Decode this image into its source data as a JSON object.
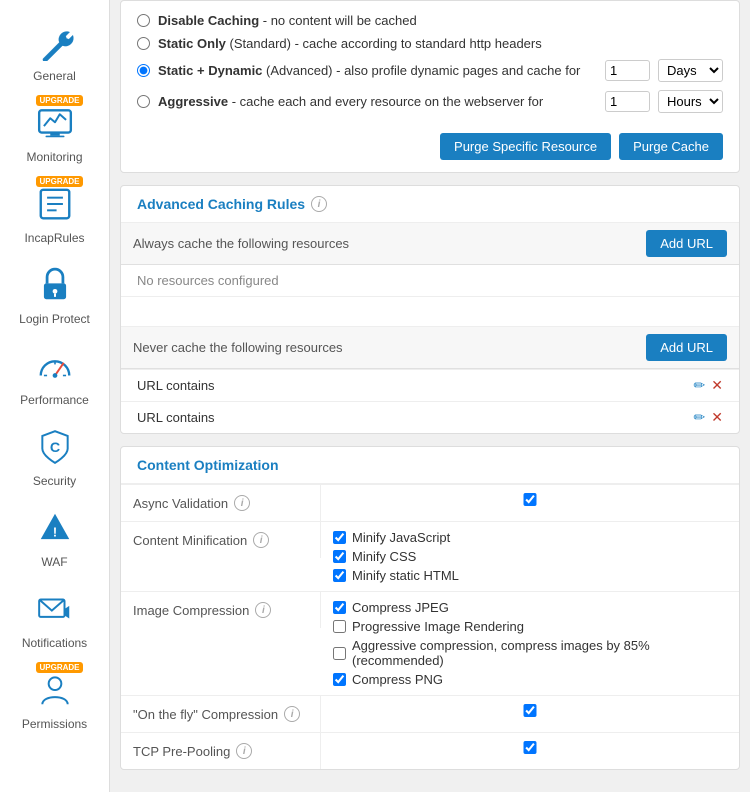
{
  "sidebar": {
    "items": [
      {
        "id": "general",
        "label": "General",
        "icon": "wrench",
        "upgrade": false
      },
      {
        "id": "monitoring",
        "label": "Monitoring",
        "icon": "monitor",
        "upgrade": true
      },
      {
        "id": "incaprules",
        "label": "IncapRules",
        "icon": "rules",
        "upgrade": true
      },
      {
        "id": "login-protect",
        "label": "Login Protect",
        "icon": "lock",
        "upgrade": false
      },
      {
        "id": "performance",
        "label": "Performance",
        "icon": "gauge",
        "upgrade": false
      },
      {
        "id": "security",
        "label": "Security",
        "icon": "shield-c",
        "upgrade": false
      },
      {
        "id": "waf",
        "label": "WAF",
        "icon": "warning",
        "upgrade": false
      },
      {
        "id": "notifications",
        "label": "Notifications",
        "icon": "envelope",
        "upgrade": false
      },
      {
        "id": "permissions",
        "label": "Permissions",
        "icon": "person",
        "upgrade": true
      }
    ]
  },
  "caching": {
    "options": [
      {
        "id": "disable",
        "text": "Disable Caching",
        "desc": " - no content will be cached",
        "selected": false,
        "has_input": false
      },
      {
        "id": "static",
        "text": "Static Only",
        "sub": "(Standard)",
        "desc": " - cache according to standard http headers",
        "selected": false,
        "has_input": false
      },
      {
        "id": "static_dynamic",
        "text": "Static + Dynamic",
        "sub": "(Advanced)",
        "desc": " - also profile dynamic pages and cache for",
        "selected": true,
        "has_input": true,
        "value": "1",
        "unit": "Days"
      },
      {
        "id": "aggressive",
        "text": "Aggressive",
        "desc": " - cache each and every resource on the webserver for",
        "selected": false,
        "has_input": true,
        "value": "1",
        "unit": "Hours"
      }
    ],
    "purge_specific_label": "Purge Specific Resource",
    "purge_cache_label": "Purge Cache"
  },
  "advanced_caching": {
    "title": "Advanced Caching Rules",
    "always_cache_label": "Always cache the following resources",
    "never_cache_label": "Never cache the following resources",
    "add_url_label": "Add URL",
    "no_resources_label": "No resources configured",
    "url_contains_label": "URL contains"
  },
  "content_optimization": {
    "title": "Content Optimization",
    "rows": [
      {
        "id": "async-validation",
        "label": "Async Validation",
        "has_info": true,
        "controls": [
          {
            "id": "async-val-cb",
            "label": "",
            "checked": true,
            "solo": true
          }
        ]
      },
      {
        "id": "content-minification",
        "label": "Content Minification",
        "has_info": true,
        "controls": [
          {
            "id": "minify-js",
            "label": "Minify JavaScript",
            "checked": true
          },
          {
            "id": "minify-css",
            "label": "Minify CSS",
            "checked": true
          },
          {
            "id": "minify-html",
            "label": "Minify static HTML",
            "checked": true
          }
        ]
      },
      {
        "id": "image-compression",
        "label": "Image Compression",
        "has_info": true,
        "controls": [
          {
            "id": "compress-jpeg",
            "label": "Compress JPEG",
            "checked": true
          },
          {
            "id": "progressive-img",
            "label": "Progressive Image Rendering",
            "checked": false
          },
          {
            "id": "aggressive-compress",
            "label": "Aggressive compression, compress images by 85% (recommended)",
            "checked": false
          },
          {
            "id": "compress-png",
            "label": "Compress PNG",
            "checked": true
          }
        ]
      },
      {
        "id": "onthefly-compression",
        "label": "\"On the fly\" Compression",
        "has_info": true,
        "controls": [
          {
            "id": "onthefly-cb",
            "label": "",
            "checked": true,
            "solo": true
          }
        ]
      },
      {
        "id": "tcp-prepooling",
        "label": "TCP Pre-Pooling",
        "has_info": true,
        "controls": [
          {
            "id": "tcp-cb",
            "label": "",
            "checked": true,
            "solo": true
          }
        ]
      }
    ]
  }
}
